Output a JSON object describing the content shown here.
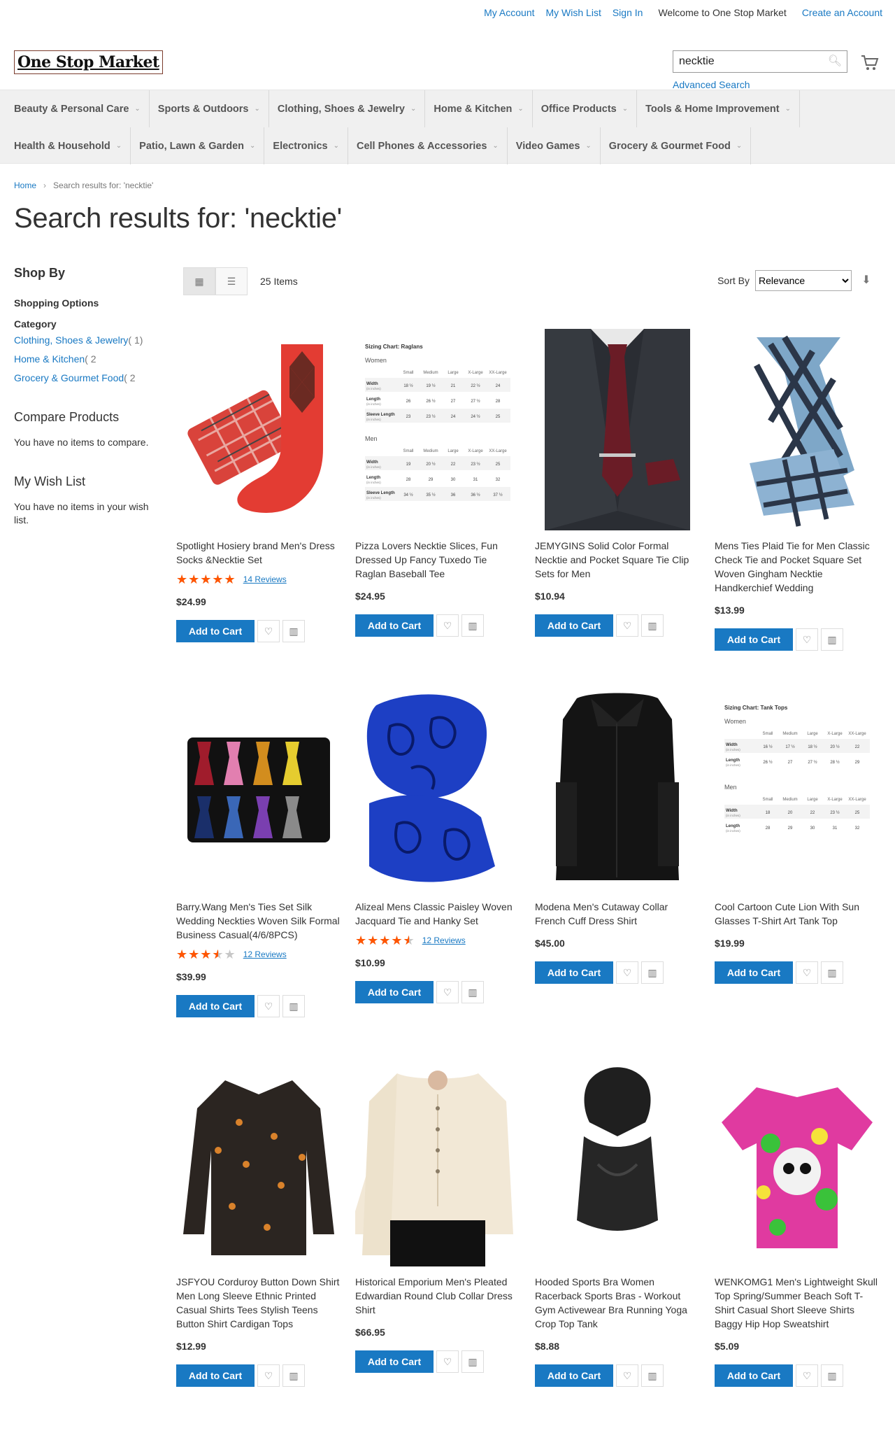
{
  "header": {
    "links": {
      "my_account": "My Account",
      "wish_list": "My Wish List",
      "sign_in": "Sign In",
      "welcome": "Welcome to One Stop Market",
      "create_account": "Create an Account"
    },
    "logo": "One Stop Market",
    "search": {
      "value": "necktie"
    },
    "advanced_search": "Advanced Search"
  },
  "nav": {
    "row1": [
      "Beauty & Personal Care",
      "Sports & Outdoors",
      "Clothing, Shoes & Jewelry",
      "Home & Kitchen",
      "Office Products",
      "Tools & Home Improvement"
    ],
    "row2": [
      "Health & Household",
      "Patio, Lawn & Garden",
      "Electronics",
      "Cell Phones & Accessories",
      "Video Games",
      "Grocery & Gourmet Food"
    ]
  },
  "breadcrumb": {
    "home": "Home",
    "current": "Search results for: 'necktie'"
  },
  "page_title": "Search results for: 'necktie'",
  "sidebar": {
    "shop_by": "Shop By",
    "shopping_options": "Shopping Options",
    "category": "Category",
    "filters": [
      {
        "label": "Clothing, Shoes & Jewelry",
        "count": "( 1)"
      },
      {
        "label": "Home & Kitchen",
        "count": "( 2"
      },
      {
        "label": "Grocery & Gourmet Food",
        "count": "( 2"
      }
    ],
    "compare_title": "Compare Products",
    "compare_empty": "You have no items to compare.",
    "wishlist_title": "My Wish List",
    "wishlist_empty": "You have no items in your wish list."
  },
  "toolbar": {
    "amount": "25 Items",
    "sort_label": "Sort By",
    "sort_value": "Relevance"
  },
  "labels": {
    "add_to_cart": "Add to Cart"
  },
  "products": [
    {
      "name": "Spotlight Hosiery brand Men's Dress Socks &Necktie Set",
      "price": "$24.99",
      "rating": 100,
      "reviews": "14  Reviews"
    },
    {
      "name": "Pizza Lovers Necktie Slices, Fun Dressed Up Fancy Tuxedo Tie Raglan Baseball Tee",
      "price": "$24.95"
    },
    {
      "name": "JEMYGINS Solid Color Formal Necktie and Pocket Square Tie Clip Sets for Men",
      "price": "$10.94"
    },
    {
      "name": "Mens Ties Plaid Tie for Men Classic Check Tie and Pocket Square Set Woven Gingham Necktie Handkerchief Wedding",
      "price": "$13.99"
    },
    {
      "name": "Barry.Wang Men's Ties Set Silk Wedding Neckties Woven Silk Formal Business Casual(4/6/8PCS)",
      "price": "$39.99",
      "rating": 70,
      "reviews": "12  Reviews"
    },
    {
      "name": "Alizeal Mens Classic Paisley Woven Jacquard Tie and Hanky Set",
      "price": "$10.99",
      "rating": 90,
      "reviews": "12  Reviews"
    },
    {
      "name": "Modena Men's Cutaway Collar French Cuff Dress Shirt",
      "price": "$45.00"
    },
    {
      "name": "Cool Cartoon Cute Lion With Sun Glasses T-Shirt Art Tank Top",
      "price": "$19.99"
    },
    {
      "name": "JSFYOU Corduroy Button Down Shirt Men Long Sleeve Ethnic Printed Casual Shirts Tees Stylish Teens Button Shirt Cardigan Tops",
      "price": "$12.99"
    },
    {
      "name": "Historical Emporium Men's Pleated Edwardian Round Club Collar Dress Shirt",
      "price": "$66.95"
    },
    {
      "name": "Hooded Sports Bra Women Racerback Sports Bras - Workout Gym Activewear Bra Running Yoga Crop Top Tank",
      "price": "$8.88"
    },
    {
      "name": "WENKOMG1 Men's Lightweight Skull Top Spring/Summer Beach Soft T-Shirt Casual Short Sleeve Shirts Baggy Hip Hop Sweatshirt",
      "price": "$5.09"
    }
  ],
  "chart_sizing": {
    "women": {
      "heading": "Sizing Chart: Raglans",
      "group": "Women",
      "columns": [
        "Small",
        "Medium",
        "Large",
        "X-Large",
        "XX-Large"
      ],
      "rows": [
        {
          "label": "Width",
          "unit": "(in inches)",
          "values": [
            "18 ½",
            "19 ½",
            "21",
            "22 ½",
            "24"
          ]
        },
        {
          "label": "Length",
          "unit": "(in inches)",
          "values": [
            "26",
            "26 ½",
            "27",
            "27 ½",
            "28"
          ]
        },
        {
          "label": "Sleeve Length",
          "unit": "(in inches)",
          "values": [
            "23",
            "23 ½",
            "24",
            "24 ½",
            "25"
          ]
        }
      ]
    },
    "men": {
      "group": "Men",
      "columns": [
        "Small",
        "Medium",
        "Large",
        "X-Large",
        "XX-Large"
      ],
      "rows": [
        {
          "label": "Width",
          "unit": "(in inches)",
          "values": [
            "19",
            "20 ½",
            "22",
            "23 ½",
            "25"
          ]
        },
        {
          "label": "Length",
          "unit": "(in inches)",
          "values": [
            "28",
            "29",
            "30",
            "31",
            "32"
          ]
        },
        {
          "label": "Sleeve Length",
          "unit": "(in inches)",
          "values": [
            "34 ½",
            "35 ½",
            "36",
            "36 ½",
            "37 ½"
          ]
        }
      ]
    },
    "tank_heading": "Sizing Chart: Tank Tops",
    "tank_women": {
      "group": "Women",
      "values": [
        [
          "16 ½",
          "17 ½",
          "18 ½",
          "20 ½",
          "22"
        ],
        [
          "26 ½",
          "27",
          "27 ½",
          "28 ½",
          "29"
        ]
      ]
    },
    "tank_men": {
      "group": "Men",
      "values": [
        [
          "18",
          "20",
          "22",
          "23 ½",
          "25"
        ],
        [
          "28",
          "29",
          "30",
          "31",
          "32"
        ]
      ]
    }
  }
}
